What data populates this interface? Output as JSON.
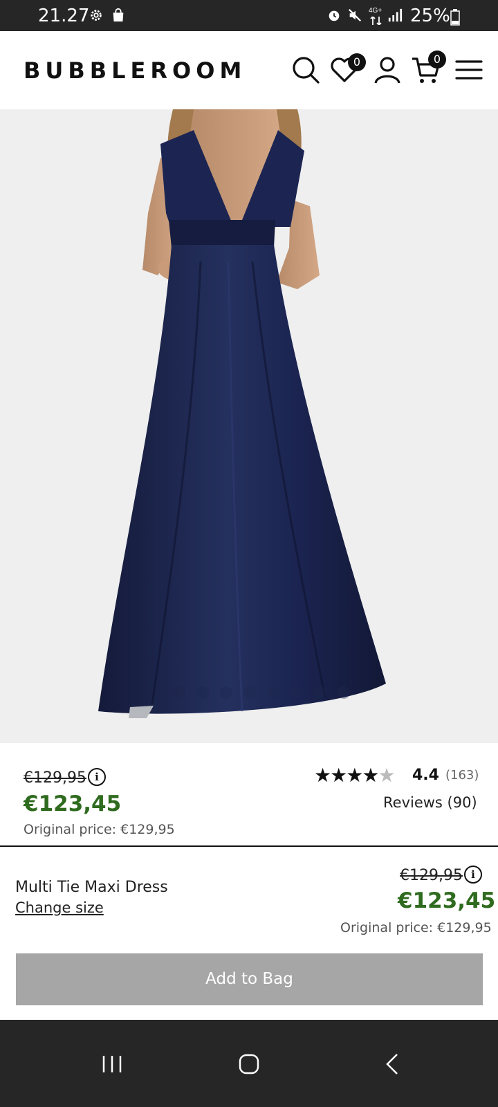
{
  "status_bar": {
    "time": "21.27",
    "battery": "25%",
    "network": "4G+",
    "icons": [
      "settings-icon",
      "shopping-bag-icon",
      "alarm-icon",
      "mute-icon",
      "network-icon",
      "signal-icon",
      "battery-icon"
    ]
  },
  "header": {
    "logo": "BUBBLEROOM",
    "wishlist_count": "0",
    "cart_count": "0",
    "icons": [
      "search-icon",
      "heart-icon",
      "user-icon",
      "cart-icon",
      "menu-icon"
    ]
  },
  "gallery": {
    "slide_count": 8,
    "active_index": 0
  },
  "pricing": {
    "old_price": "€129,95",
    "new_price": "€123,45",
    "original_price": "Original price: €129,95"
  },
  "rating": {
    "stars": 4.4,
    "value": "4.4",
    "count": "(163)",
    "reviews_link": "Reviews (90)"
  },
  "sticky": {
    "product_name": "Multi Tie Maxi Dress",
    "change_size": "Change size",
    "old_price": "€129,95",
    "new_price": "€123,45",
    "original_price": "Original price: €129,95",
    "add_to_bag": "Add to Bag"
  },
  "colors": {
    "sale_green": "#2f6b1f",
    "button_gray": "#a6a6a6",
    "dress_navy": "#1e274d",
    "bar_dark": "#262626"
  }
}
